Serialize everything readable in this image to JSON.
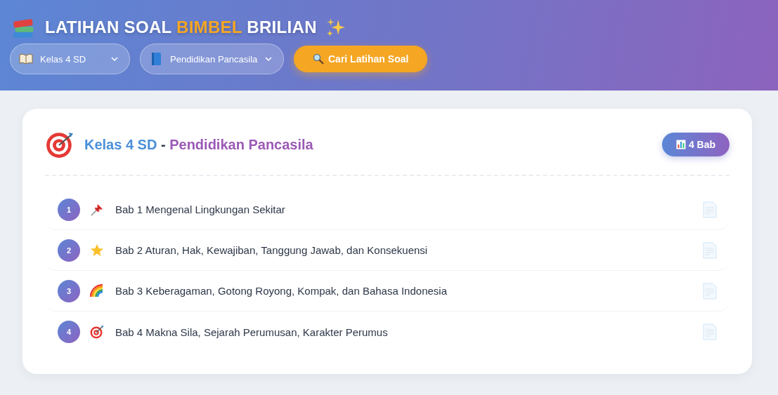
{
  "header": {
    "title_before": "LATIHAN SOAL",
    "title_highlight": "BIMBEL",
    "title_after": "BRILIAN"
  },
  "filters": [
    {
      "kind": "grade",
      "value": "Kelas 4 SD"
    },
    {
      "kind": "subject",
      "value": "Pendidikan Pancasila"
    }
  ],
  "search_button": {
    "label": "Cari Latihan Soal"
  },
  "card": {
    "grade": "Kelas 4 SD",
    "separator": "-",
    "subject": "Pendidikan Pancasila",
    "badge": "4 Bab",
    "chapters": [
      {
        "number": "1",
        "kind": "pin",
        "title": "Bab 1 Mengenal Lingkungan Sekitar"
      },
      {
        "number": "2",
        "kind": "star",
        "title": "Bab 2 Aturan, Hak, Kewajiban, Tanggung Jawab, dan Konsekuensi"
      },
      {
        "number": "3",
        "kind": "rainbow",
        "title": "Bab 3 Keberagaman, Gotong Royong, Kompak, dan Bahasa Indonesia"
      },
      {
        "number": "4",
        "kind": "target",
        "title": "Bab 4 Makna Sila, Sejarah Perumusan, Karakter Perumus"
      }
    ]
  }
}
